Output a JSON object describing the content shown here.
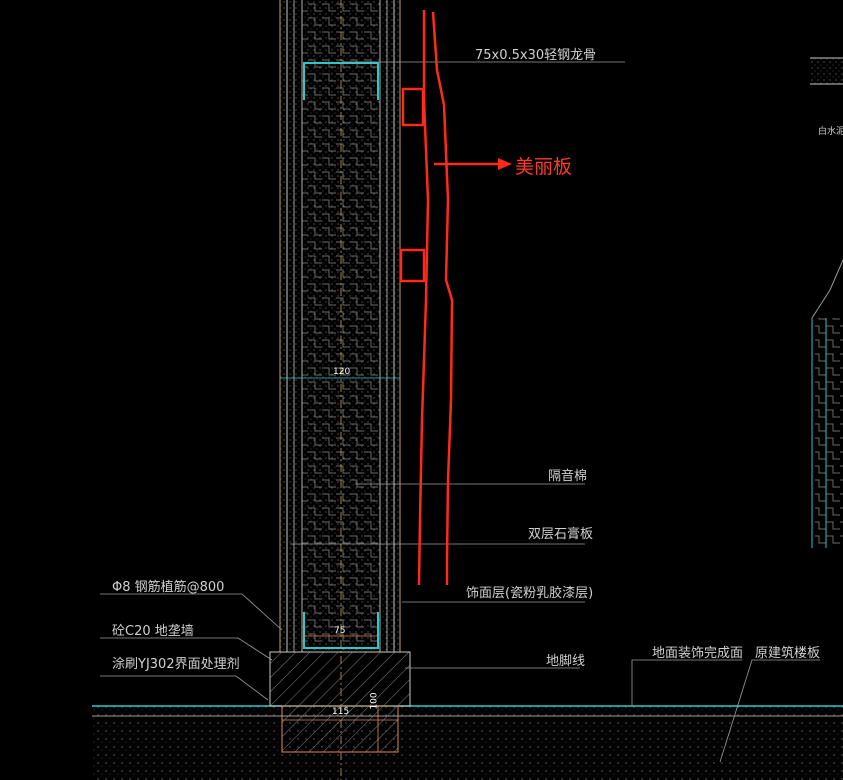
{
  "labels": {
    "stud": "75x0.5x30轻钢龙骨",
    "meili": "美丽板",
    "soundwool": "隔音棉",
    "gypsum": "双层石膏板",
    "finish": "饰面层(瓷粉乳胶漆层)",
    "rebar": "Φ8 钢筋植筋@800",
    "concrete": "砼C20 地垄墙",
    "coating": "涂刷YJ302界面处理剂",
    "skirting": "地脚线",
    "floorfinish": "地面装饰完成面",
    "slab": "原建筑楼板",
    "dim120": "120",
    "dim75": "75",
    "dim115": "115",
    "dim100": "100",
    "right_note": "白水泥砖"
  }
}
